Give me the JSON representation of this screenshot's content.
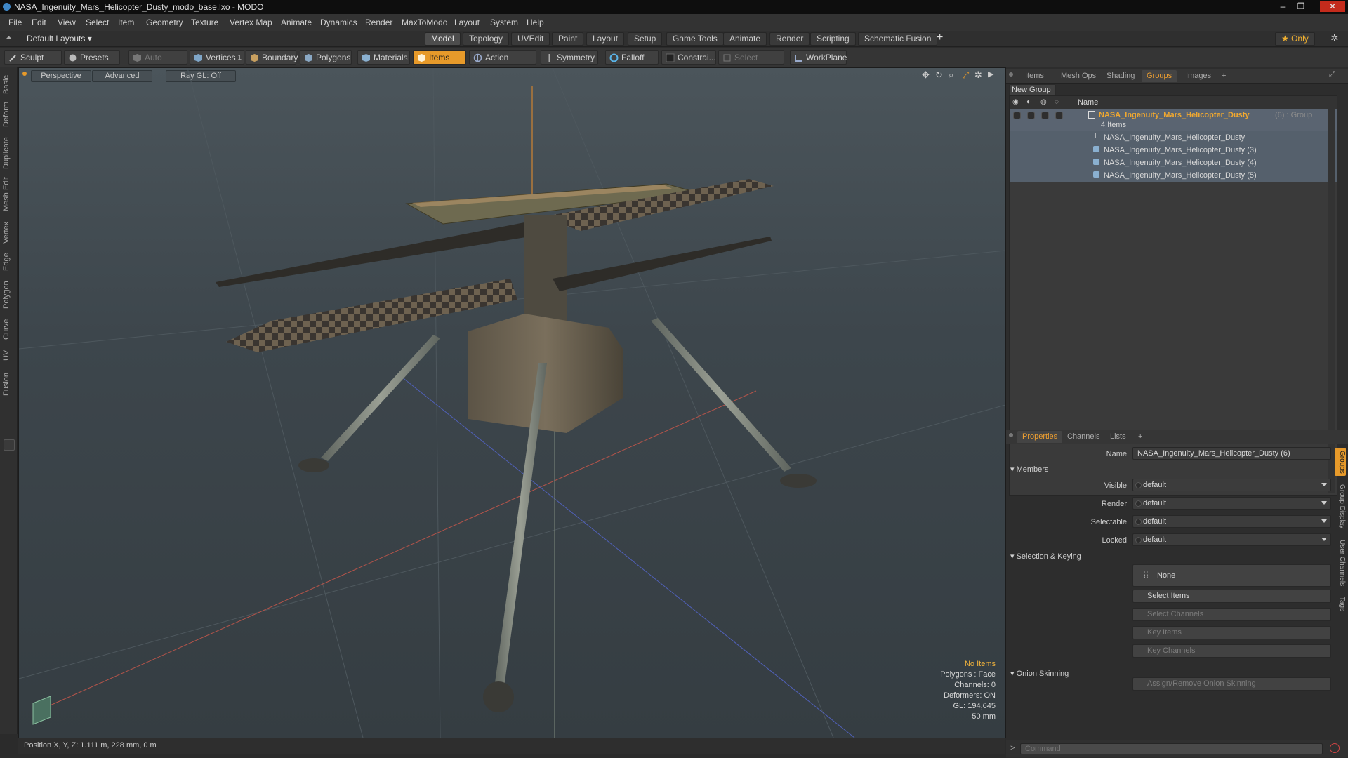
{
  "window": {
    "title": "NASA_Ingenuity_Mars_Helicopter_Dusty_modo_base.lxo - MODO",
    "minimize": "–",
    "maximize": "❐",
    "close": "✕"
  },
  "menu": [
    "File",
    "Edit",
    "View",
    "Select",
    "Item",
    "Geometry",
    "Texture",
    "Vertex Map",
    "Animate",
    "Dynamics",
    "Render",
    "MaxToModo",
    "Layout",
    "System",
    "Help"
  ],
  "layouts": {
    "preset": "Default Layouts ▾",
    "tabs": [
      "Model",
      "Topology",
      "UVEdit",
      "Paint",
      "Layout",
      "Setup",
      "Game Tools",
      "Animate",
      "Render",
      "Scripting",
      "Schematic Fusion"
    ],
    "active": "Model",
    "add": "+",
    "only": "★  Only",
    "gear": "✲"
  },
  "toolbar": {
    "sculpt": "Sculpt",
    "presets": "Presets",
    "auto_select": "Auto Select",
    "vertices": "Vertices",
    "vertices_count": "1",
    "boundary": "Boundary",
    "polygons": "Polygons",
    "materials": "Materials",
    "items": "Items",
    "action_center": "Action Center",
    "symmetry": "Symmetry",
    "falloff": "Falloff",
    "constraints": "Constrai...",
    "select_through": "Select Through",
    "workplane": "WorkPlane"
  },
  "left_tabs": [
    "Basic",
    "Deform",
    "Duplicate",
    "Mesh Edit",
    "Vertex",
    "Edge",
    "Polygon",
    "Curve",
    "UV",
    "Fusion"
  ],
  "viewport": {
    "perspective": "Perspective",
    "advanced": "Advanced",
    "raygl": "Ray GL: Off",
    "info": {
      "no_items": "No Items",
      "polygons": "Polygons : Face",
      "channels": "Channels: 0",
      "deformers": "Deformers: ON",
      "gl": "GL: 194,645",
      "scale": "50 mm"
    }
  },
  "status": {
    "position": "Position X, Y, Z:   1.111 m, 228 mm, 0 m"
  },
  "top_panel": {
    "tabs": [
      "Items",
      "Mesh Ops",
      "Shading",
      "Groups",
      "Images"
    ],
    "active": "Groups",
    "add": "+",
    "new_group": "New Group",
    "column_name": "Name",
    "group": {
      "name": "NASA_Ingenuity_Mars_Helicopter_Dusty",
      "suffix": "(6) : Group",
      "count": "4 Items"
    },
    "children": [
      "NASA_Ingenuity_Mars_Helicopter_Dusty",
      "NASA_Ingenuity_Mars_Helicopter_Dusty (3)",
      "NASA_Ingenuity_Mars_Helicopter_Dusty (4)",
      "NASA_Ingenuity_Mars_Helicopter_Dusty (5)"
    ]
  },
  "bottom_panel": {
    "tabs": [
      "Properties",
      "Channels",
      "Lists"
    ],
    "active": "Properties",
    "add": "+",
    "name_label": "Name",
    "name_value": "NASA_Ingenuity_Mars_Helicopter_Dusty (6)",
    "members": "Members",
    "visible_label": "Visible",
    "visible": "default",
    "render_label": "Render",
    "render": "default",
    "selectable_label": "Selectable",
    "selectable": "default",
    "locked_label": "Locked",
    "locked": "default",
    "selection_keying": "Selection & Keying",
    "none": "None",
    "select_items": "Select Items",
    "select_channels": "Select Channels",
    "key_items": "Key Items",
    "key_channels": "Key Channels",
    "onion": "Onion Skinning",
    "assign_onion": "Assign/Remove Onion Skinning",
    "side_tabs": [
      "Groups",
      "Group Display",
      "User Channels",
      "Tags"
    ],
    "side_active": "Groups",
    "command_placeholder": "Command"
  },
  "colors": {
    "accent": "#e79a2a",
    "selection": "#5a6471",
    "background": "#2b2b2b"
  }
}
